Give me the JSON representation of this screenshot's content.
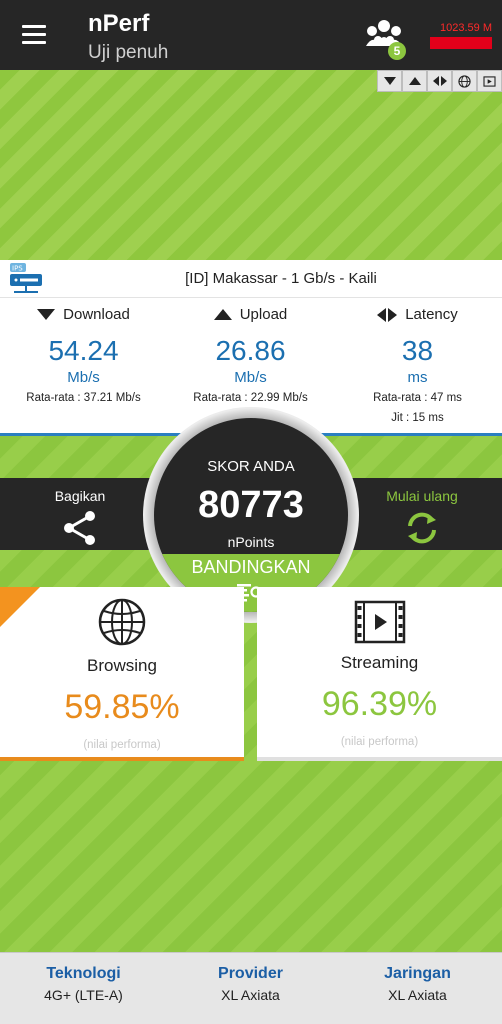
{
  "header": {
    "title": "nPerf",
    "subtitle": "Uji penuh",
    "community_count": "5",
    "memory": "1023.59 M"
  },
  "server": {
    "name": "[ID] Makassar - 1 Gb/s - Kaili",
    "logo_text": "IPS"
  },
  "results": {
    "download": {
      "label": "Download",
      "value": "54.24",
      "unit": "Mb/s",
      "average": "Rata-rata : 37.21 Mb/s"
    },
    "upload": {
      "label": "Upload",
      "value": "26.86",
      "unit": "Mb/s",
      "average": "Rata-rata : 22.99 Mb/s"
    },
    "latency": {
      "label": "Latency",
      "value": "38",
      "unit": "ms",
      "average": "Rata-rata : 47 ms",
      "jitter": "Jit : 15 ms"
    }
  },
  "actions": {
    "share": "Bagikan",
    "restart": "Mulai ulang"
  },
  "score": {
    "label": "SKOR ANDA",
    "value": "80773",
    "unit": "nPoints",
    "compare": "BANDINGKAN"
  },
  "cards": {
    "browsing": {
      "title": "Browsing",
      "percent": "59.85%",
      "note": "(nilai performa)",
      "color": "#e88b1c"
    },
    "streaming": {
      "title": "Streaming",
      "percent": "96.39%",
      "note": "(nilai performa)",
      "color": "#8cc63f"
    }
  },
  "footer": {
    "technology": {
      "label": "Teknologi",
      "value": "4G+ (LTE-A)"
    },
    "provider": {
      "label": "Provider",
      "value": "XL Axiata"
    },
    "network": {
      "label": "Jaringan",
      "value": "XL Axiata"
    }
  },
  "colors": {
    "accent": "#8cc63f",
    "header": "#262626",
    "blue": "#1b6fb0",
    "orange": "#e88b1c"
  }
}
